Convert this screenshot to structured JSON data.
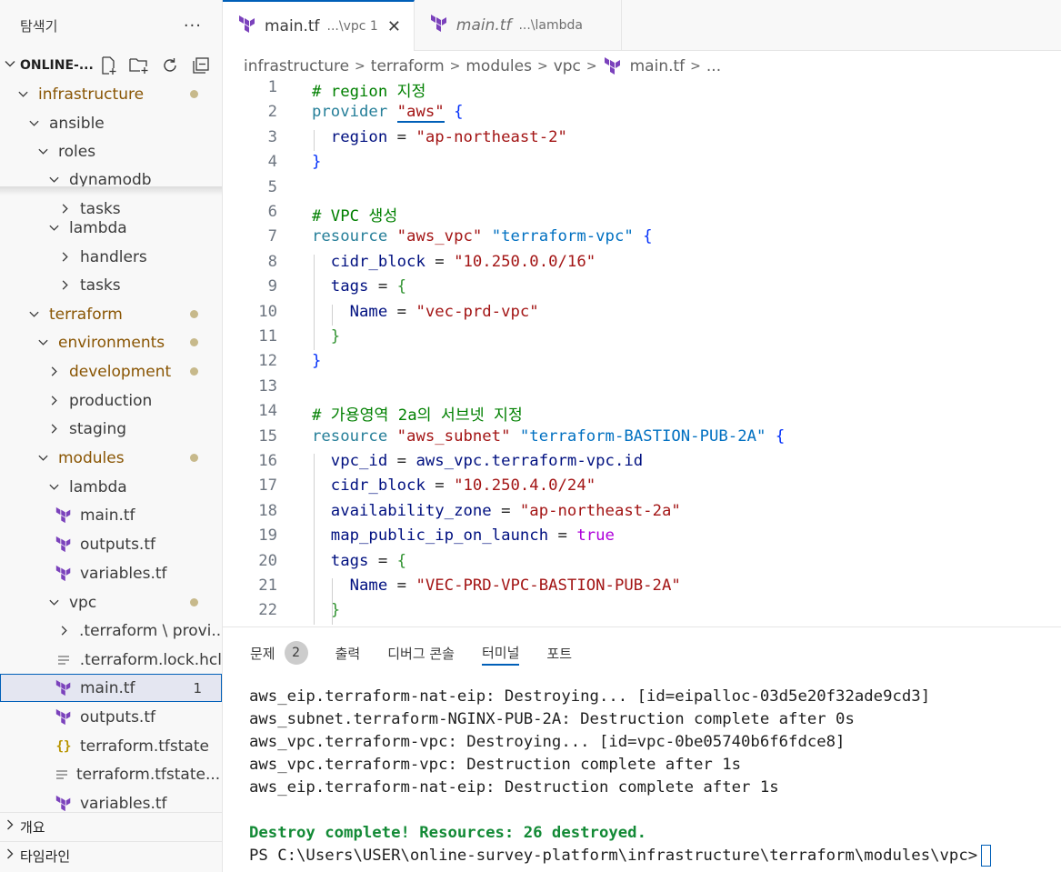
{
  "sidebar": {
    "title": "탐색기",
    "more": "···",
    "section": "ONLINE-...",
    "tree": [
      {
        "label": "infrastructure",
        "depth": 1,
        "open": true,
        "mod": true,
        "dot": true
      },
      {
        "label": "ansible",
        "depth": 2,
        "open": true
      },
      {
        "label": "roles",
        "depth": 3,
        "open": true
      },
      {
        "label": "dynamodb",
        "depth": 4,
        "open": true
      },
      {
        "label": "tasks",
        "depth": 5,
        "open": false
      },
      {
        "label": "lambda",
        "depth": 4,
        "open": true
      },
      {
        "label": "handlers",
        "depth": 5,
        "open": false
      },
      {
        "label": "tasks",
        "depth": 5,
        "open": false
      },
      {
        "label": "terraform",
        "depth": 2,
        "open": true,
        "mod": true,
        "dot": true
      },
      {
        "label": "environments",
        "depth": 3,
        "open": true,
        "mod": true,
        "dot": true
      },
      {
        "label": "development",
        "depth": 4,
        "open": false,
        "mod": true,
        "dot": true
      },
      {
        "label": "production",
        "depth": 4,
        "open": false
      },
      {
        "label": "staging",
        "depth": 4,
        "open": false
      },
      {
        "label": "modules",
        "depth": 3,
        "open": true,
        "mod": true,
        "dot": true
      },
      {
        "label": "lambda",
        "depth": 4,
        "open": true
      },
      {
        "label": "main.tf",
        "depth": 5,
        "file": "tf"
      },
      {
        "label": "outputs.tf",
        "depth": 5,
        "file": "tf"
      },
      {
        "label": "variables.tf",
        "depth": 5,
        "file": "tf"
      },
      {
        "label": "vpc",
        "depth": 4,
        "open": true,
        "dot": true
      },
      {
        "label": ".terraform \\ provi...",
        "depth": 5,
        "open": false
      },
      {
        "label": ".terraform.lock.hcl",
        "depth": 5,
        "file": "lines"
      },
      {
        "label": "main.tf",
        "depth": 5,
        "file": "tf",
        "selected": true,
        "badge": "1"
      },
      {
        "label": "outputs.tf",
        "depth": 5,
        "file": "tf"
      },
      {
        "label": "terraform.tfstate",
        "depth": 5,
        "file": "json"
      },
      {
        "label": "terraform.tfstate....",
        "depth": 5,
        "file": "lines"
      },
      {
        "label": "variables.tf",
        "depth": 5,
        "file": "tf"
      }
    ],
    "outline": "개요",
    "timeline": "타임라인"
  },
  "tabs": [
    {
      "name": "main.tf",
      "desc": "...\\vpc 1",
      "active": true,
      "close": "✕"
    },
    {
      "name": "main.tf",
      "desc": "...\\lambda",
      "active": false
    }
  ],
  "breadcrumb": [
    "infrastructure",
    "terraform",
    "modules",
    "vpc",
    "main.tf",
    "..."
  ],
  "code": [
    {
      "n": "1",
      "parts": [
        [
          "c-com",
          "# region 지정"
        ]
      ]
    },
    {
      "n": "2",
      "parts": [
        [
          "c-kw",
          "provider "
        ],
        [
          "c-str aws-under",
          "\"aws\""
        ],
        [
          "c-op",
          " "
        ],
        [
          "c-b1",
          "{"
        ]
      ]
    },
    {
      "n": "3",
      "parts": [
        [
          "c-attr",
          "  region"
        ],
        [
          "c-op",
          " = "
        ],
        [
          "c-str",
          "\"ap-northeast-2\""
        ]
      ]
    },
    {
      "n": "4",
      "parts": [
        [
          "c-b1",
          "}"
        ]
      ]
    },
    {
      "n": "5",
      "parts": []
    },
    {
      "n": "6",
      "parts": [
        [
          "c-com",
          "# VPC 생성"
        ]
      ]
    },
    {
      "n": "7",
      "parts": [
        [
          "c-kw",
          "resource "
        ],
        [
          "c-str",
          "\"aws_vpc\""
        ],
        [
          "c-op",
          " "
        ],
        [
          "c-key",
          "\"terraform-vpc\""
        ],
        [
          "c-op",
          " "
        ],
        [
          "c-b1",
          "{"
        ]
      ]
    },
    {
      "n": "8",
      "parts": [
        [
          "c-attr",
          "  cidr_block"
        ],
        [
          "c-op",
          " = "
        ],
        [
          "c-str",
          "\"10.250.0.0/16\""
        ]
      ]
    },
    {
      "n": "9",
      "parts": [
        [
          "c-attr",
          "  tags"
        ],
        [
          "c-op",
          " = "
        ],
        [
          "c-b2",
          "{"
        ]
      ]
    },
    {
      "n": "10",
      "parts": [
        [
          "c-attr",
          "    Name"
        ],
        [
          "c-op",
          " = "
        ],
        [
          "c-str",
          "\"vec-prd-vpc\""
        ]
      ]
    },
    {
      "n": "11",
      "parts": [
        [
          "c-b2",
          "  }"
        ]
      ]
    },
    {
      "n": "12",
      "parts": [
        [
          "c-b1",
          "}"
        ]
      ]
    },
    {
      "n": "13",
      "parts": []
    },
    {
      "n": "14",
      "parts": [
        [
          "c-com",
          "# 가용영역 2a의 서브넷 지정"
        ]
      ]
    },
    {
      "n": "15",
      "parts": [
        [
          "c-kw",
          "resource "
        ],
        [
          "c-str",
          "\"aws_subnet\""
        ],
        [
          "c-op",
          " "
        ],
        [
          "c-key",
          "\"terraform-BASTION-PUB-2A\""
        ],
        [
          "c-op",
          " "
        ],
        [
          "c-b1",
          "{"
        ]
      ]
    },
    {
      "n": "16",
      "parts": [
        [
          "c-attr",
          "  vpc_id"
        ],
        [
          "c-op",
          " = "
        ],
        [
          "c-attr",
          "aws_vpc.terraform-vpc.id"
        ]
      ]
    },
    {
      "n": "17",
      "parts": [
        [
          "c-attr",
          "  cidr_block"
        ],
        [
          "c-op",
          " = "
        ],
        [
          "c-str",
          "\"10.250.4.0/24\""
        ]
      ]
    },
    {
      "n": "18",
      "parts": [
        [
          "c-attr",
          "  availability_zone"
        ],
        [
          "c-op",
          " = "
        ],
        [
          "c-str",
          "\"ap-northeast-2a\""
        ]
      ]
    },
    {
      "n": "19",
      "parts": [
        [
          "c-attr",
          "  map_public_ip_on_launch"
        ],
        [
          "c-op",
          " = "
        ],
        [
          "c-true",
          "true"
        ]
      ]
    },
    {
      "n": "20",
      "parts": [
        [
          "c-attr",
          "  tags"
        ],
        [
          "c-op",
          " = "
        ],
        [
          "c-b2",
          "{"
        ]
      ]
    },
    {
      "n": "21",
      "parts": [
        [
          "c-attr",
          "    Name"
        ],
        [
          "c-op",
          " = "
        ],
        [
          "c-str",
          "\"VEC-PRD-VPC-BASTION-PUB-2A\""
        ]
      ]
    },
    {
      "n": "22",
      "parts": [
        [
          "c-b2",
          "  }"
        ]
      ]
    }
  ],
  "panel": {
    "tabs": [
      {
        "label": "문제",
        "count": "2"
      },
      {
        "label": "출력"
      },
      {
        "label": "디버그 콘솔"
      },
      {
        "label": "터미널",
        "active": true
      },
      {
        "label": "포트"
      }
    ],
    "terminal": [
      {
        "text": "aws_eip.terraform-nat-eip: Destroying... [id=eipalloc-03d5e20f32ade9cd3]"
      },
      {
        "text": "aws_subnet.terraform-NGINX-PUB-2A: Destruction complete after 0s"
      },
      {
        "text": "aws_vpc.terraform-vpc: Destroying... [id=vpc-0be05740b6f6fdce8]"
      },
      {
        "text": "aws_vpc.terraform-vpc: Destruction complete after 1s"
      },
      {
        "text": "aws_eip.terraform-nat-eip: Destruction complete after 1s"
      },
      {
        "text": ""
      },
      {
        "text": "Destroy complete! Resources: 26 destroyed.",
        "green": true
      },
      {
        "text": "PS C:\\Users\\USER\\online-survey-platform\\infrastructure\\terraform\\modules\\vpc>",
        "prompt": true
      }
    ]
  },
  "colors": {
    "accent": "#005fb8",
    "terraform": "#7b42bc",
    "modified": "#895503"
  }
}
